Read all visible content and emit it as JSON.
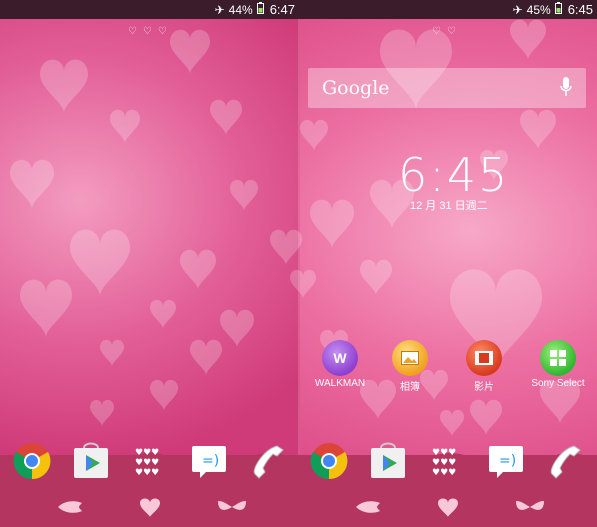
{
  "status_left": {
    "battery": "44%",
    "time": "6:47"
  },
  "status_right": {
    "battery": "45%",
    "time": "6:45"
  },
  "search": {
    "label": "Google"
  },
  "clock": {
    "time": "6:45",
    "date": "12 月 31 日週二"
  },
  "apps": [
    {
      "label": "WALKMAN",
      "icon": "walkman-icon",
      "color": "#8e3fd0"
    },
    {
      "label": "相簿",
      "icon": "album-icon",
      "color": "#f0a020"
    },
    {
      "label": "影片",
      "icon": "movies-icon",
      "color": "#d83a1e"
    },
    {
      "label": "Sony Select",
      "icon": "sony-select-icon",
      "color": "#32b532"
    }
  ],
  "dock": [
    "chrome-icon",
    "play-store-icon",
    "app-drawer-icon",
    "messaging-icon",
    "phone-icon"
  ],
  "colors": {
    "accent": "#e25e97",
    "dock": "#b4355f"
  }
}
